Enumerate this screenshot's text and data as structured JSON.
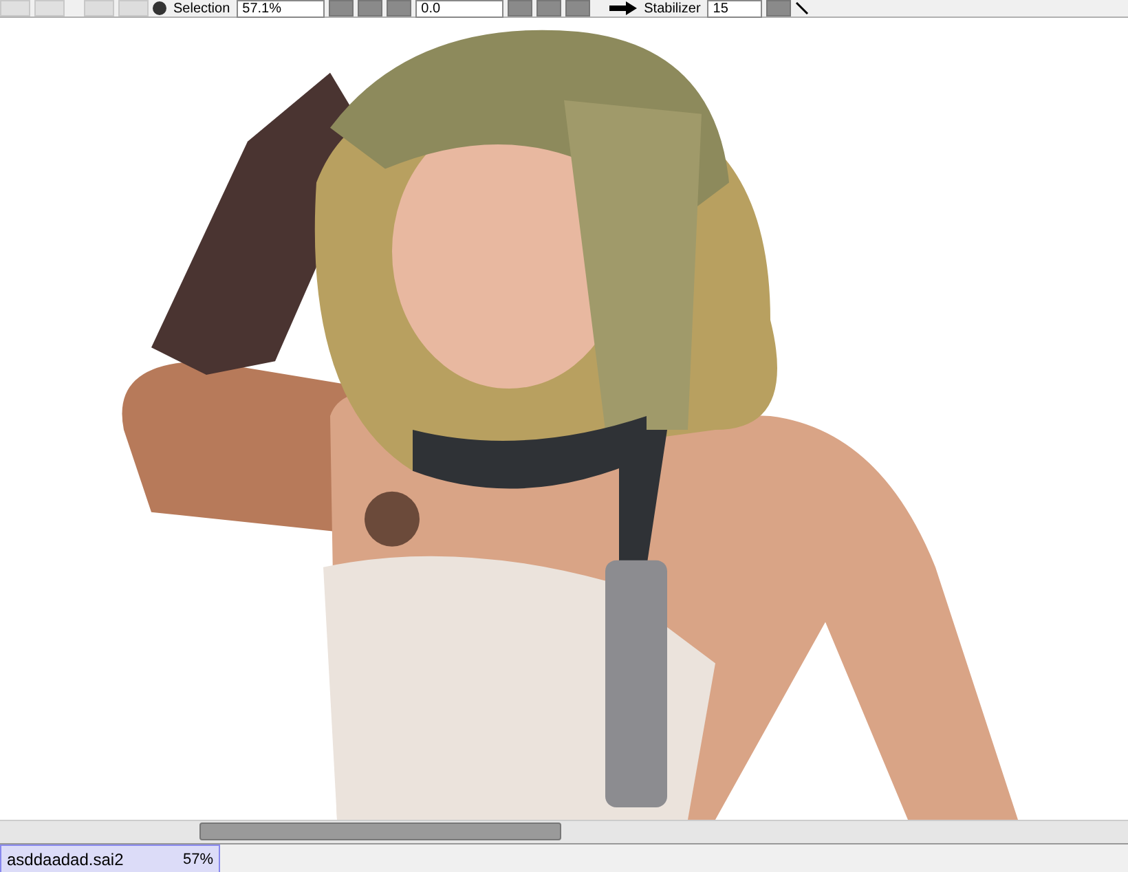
{
  "toolbar": {
    "selection_checked": true,
    "selection_label": "Selection",
    "zoom": "57.1%",
    "angle": "0.0",
    "stabilizer_label": "Stabilizer",
    "stabilizer": "15"
  },
  "file_tabs": [
    {
      "name": "asddaadad.sai2",
      "zoom": "57%",
      "selected": true
    }
  ]
}
